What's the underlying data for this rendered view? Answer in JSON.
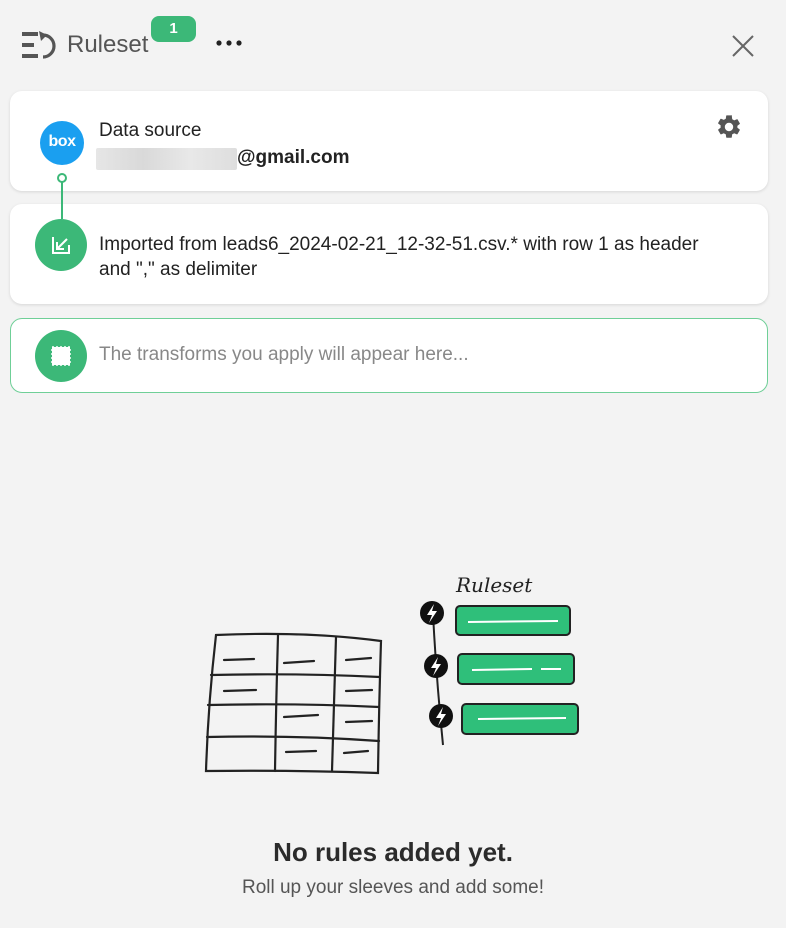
{
  "header": {
    "title": "Ruleset",
    "badge_count": "1",
    "more_icon": "more-horizontal-icon",
    "close_icon": "close-icon"
  },
  "data_source": {
    "label": "Data source",
    "email_visible": "@gmail.com",
    "provider_logo": "box",
    "settings_icon": "gear-icon"
  },
  "import_step": {
    "text": "Imported from leads6_2024-02-21_12-32-51.csv.* with row 1 as header and \",\" as delimiter",
    "icon": "import-arrow-icon"
  },
  "transform_step": {
    "placeholder": "The transforms you apply will appear here...",
    "icon": "dashed-square-icon"
  },
  "illustration": {
    "caption": "Ruleset"
  },
  "empty_state": {
    "title": "No rules added yet.",
    "subtitle": "Roll up your sleeves and add some!"
  },
  "colors": {
    "accent": "#3cb878",
    "box_blue": "#1a9ff0",
    "background": "#f3f3f3"
  }
}
